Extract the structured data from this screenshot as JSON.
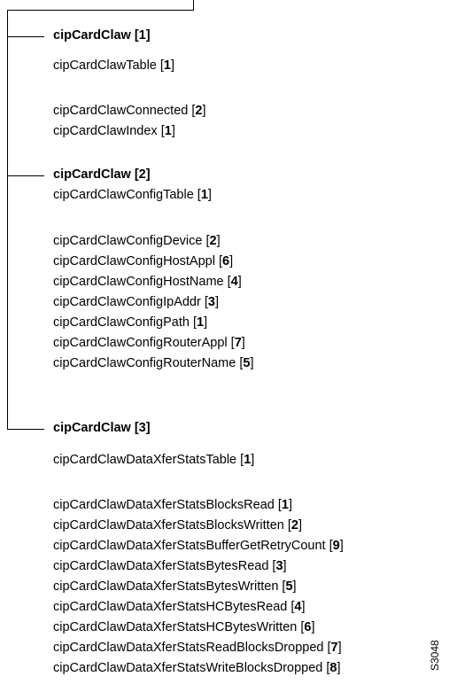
{
  "figure_id": "S3048",
  "groups": [
    {
      "heading": "cipCardClaw [1]",
      "table": {
        "name": "cipCardClawTable",
        "num": "1"
      },
      "items": [
        {
          "name": "cipCardClawConnected",
          "num": "2"
        },
        {
          "name": "cipCardClawIndex",
          "num": "1"
        }
      ]
    },
    {
      "heading": "cipCardClaw [2]",
      "table": {
        "name": "cipCardClawConfigTable",
        "num": "1"
      },
      "items": [
        {
          "name": "cipCardClawConfigDevice",
          "num": "2"
        },
        {
          "name": "cipCardClawConfigHostAppl",
          "num": "6"
        },
        {
          "name": "cipCardClawConfigHostName",
          "num": "4"
        },
        {
          "name": "cipCardClawConfigIpAddr",
          "num": "3"
        },
        {
          "name": "cipCardClawConfigPath",
          "num": "1"
        },
        {
          "name": "cipCardClawConfigRouterAppl",
          "num": "7"
        },
        {
          "name": "cipCardClawConfigRouterName",
          "num": "5"
        }
      ]
    },
    {
      "heading": "cipCardClaw [3]",
      "table": {
        "name": "cipCardClawDataXferStatsTable",
        "num": "1"
      },
      "items": [
        {
          "name": "cipCardClawDataXferStatsBlocksRead",
          "num": "1"
        },
        {
          "name": "cipCardClawDataXferStatsBlocksWritten",
          "num": "2"
        },
        {
          "name": "cipCardClawDataXferStatsBufferGetRetryCount",
          "num": "9"
        },
        {
          "name": "cipCardClawDataXferStatsBytesRead",
          "num": "3"
        },
        {
          "name": "cipCardClawDataXferStatsBytesWritten",
          "num": "5"
        },
        {
          "name": "cipCardClawDataXferStatsHCBytesRead",
          "num": "4"
        },
        {
          "name": "cipCardClawDataXferStatsHCBytesWritten",
          "num": "6"
        },
        {
          "name": "cipCardClawDataXferStatsReadBlocksDropped",
          "num": "7"
        },
        {
          "name": "cipCardClawDataXferStatsWriteBlocksDropped",
          "num": "8"
        }
      ]
    }
  ]
}
